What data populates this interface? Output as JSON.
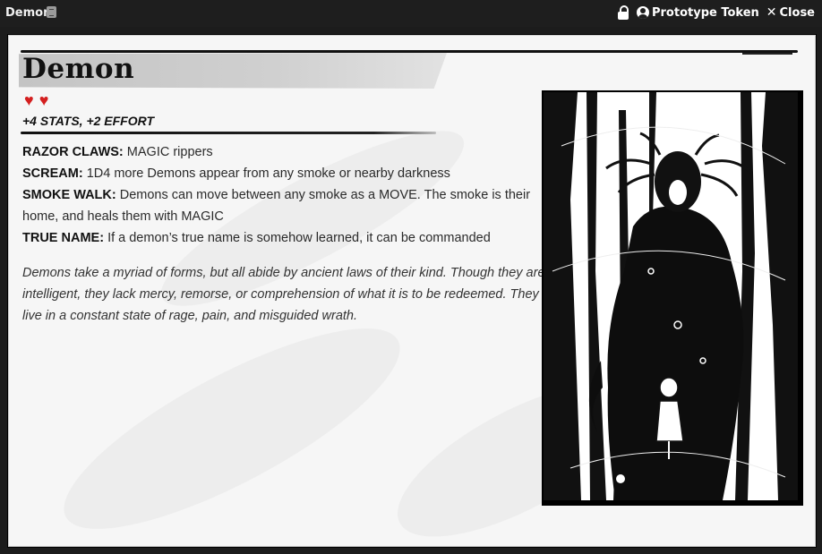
{
  "window": {
    "title": "Demon",
    "title_icon": "character-sheet-icon",
    "lock_icon": "lock-icon",
    "prototype_label": "Prototype Token",
    "close_label": "Close"
  },
  "sheet": {
    "name": "Demon",
    "hearts": 2,
    "heart_color": "#d41f1f",
    "effort": "+4 STATS, +2 EFFORT",
    "abilities": [
      {
        "name": "RAZOR CLAWS:",
        "text": "MAGIC rippers"
      },
      {
        "name": "SCREAM:",
        "text": "1D4 more Demons appear from any smoke or nearby darkness"
      },
      {
        "name": "SMOKE WALK:",
        "text": "Demons can move between any smoke as a MOVE. The smoke is their home, and heals them with MAGIC"
      },
      {
        "name": "TRUE NAME:",
        "text": "If a demon’s true name is somehow learned, it can be commanded"
      }
    ],
    "flavor": "Demons take a myriad of forms, but all abide by ancient laws of their kind. Though they are intelligent, they lack mercy, remorse, or comprehension of what it is to be redeemed. They live in a constant state of rage, pain, and misguided wrath.",
    "artwork": "demon-illustration"
  }
}
